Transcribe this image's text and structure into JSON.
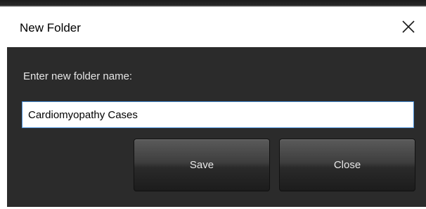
{
  "dialog": {
    "title": "New Folder",
    "close_icon": "close-icon",
    "prompt": "Enter new folder name:",
    "folder_name_value": "Cardiomyopathy Cases",
    "save_label": "Save",
    "close_label": "Close"
  },
  "colors": {
    "dialog_background": "#2b2b2b",
    "titlebar_background": "#ffffff",
    "input_border": "#4a90d9",
    "button_text": "#e8e8e8"
  }
}
